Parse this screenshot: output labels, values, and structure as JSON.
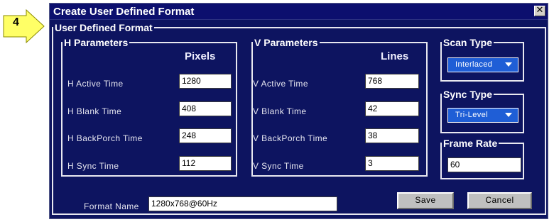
{
  "callout": {
    "number": "4"
  },
  "dialog": {
    "title": "Create User Defined Format",
    "close_glyph": "✕",
    "group_title": "User Defined Format",
    "h_params": {
      "title": "H Parameters",
      "column_header": "Pixels",
      "rows": [
        {
          "label": "H Active Time",
          "value": "1280"
        },
        {
          "label": "H Blank Time",
          "value": "408"
        },
        {
          "label": "H BackPorch Time",
          "value": "248"
        },
        {
          "label": "H Sync Time",
          "value": "112"
        }
      ]
    },
    "v_params": {
      "title": "V Parameters",
      "column_header": "Lines",
      "rows": [
        {
          "label": "V Active Time",
          "value": "768"
        },
        {
          "label": "V Blank Time",
          "value": "42"
        },
        {
          "label": "V BackPorch Time",
          "value": "38"
        },
        {
          "label": "V Sync Time",
          "value": "3"
        }
      ]
    },
    "scan_type": {
      "title": "Scan Type",
      "selected": "Interlaced"
    },
    "sync_type": {
      "title": "Sync Type",
      "selected": "Tri-Level"
    },
    "frame_rate": {
      "title": "Frame Rate",
      "value": "60"
    },
    "format_name": {
      "label": "Format Name",
      "value": "1280x768@60Hz"
    },
    "buttons": {
      "save": "Save",
      "cancel": "Cancel"
    },
    "colors": {
      "dialog_bg": "#0d1460",
      "title_bg": "#0c0f6e",
      "dropdown_bg": "#1f5ed6",
      "callout_fill": "#ffff66"
    }
  }
}
